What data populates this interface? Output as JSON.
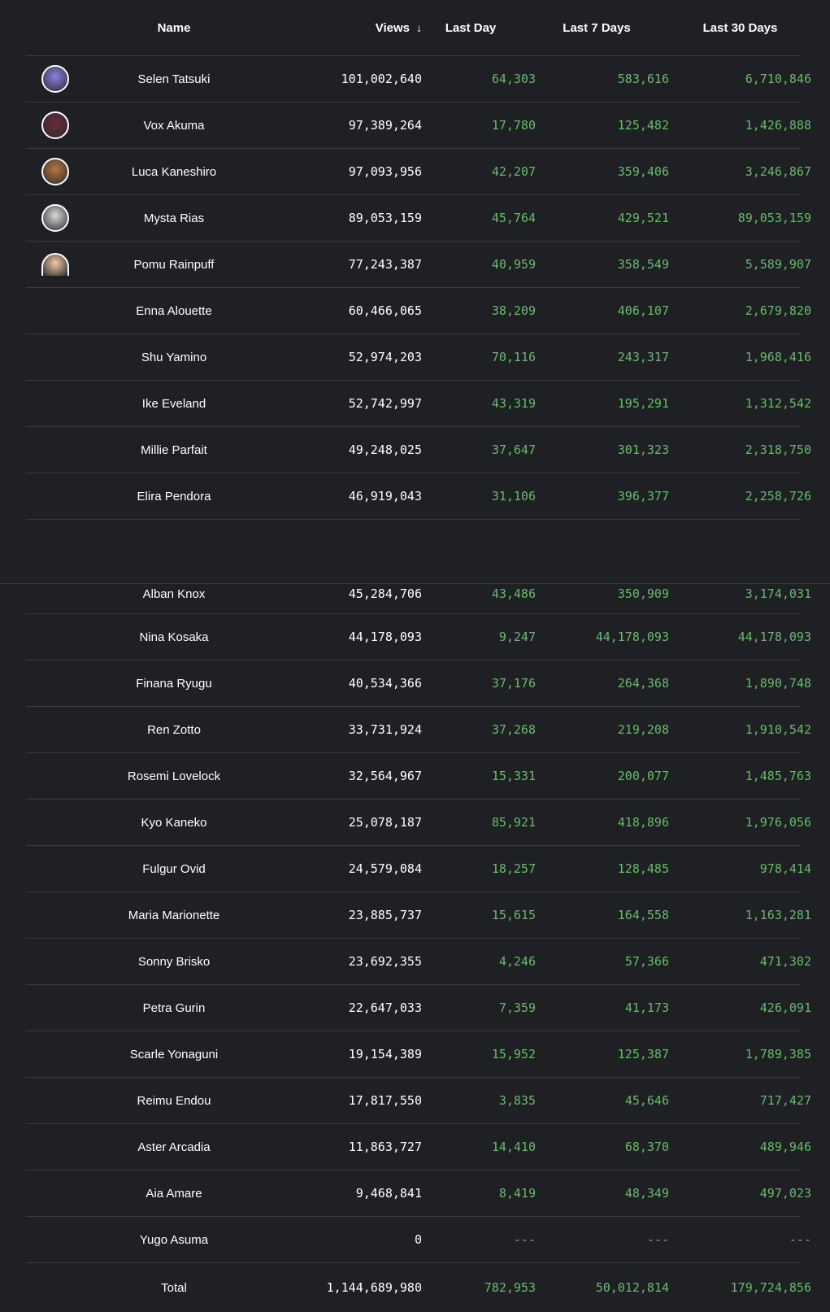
{
  "header": {
    "name": "Name",
    "views": "Views",
    "sort_icon": "arrow-down",
    "last_day": "Last Day",
    "last_7": "Last 7 Days",
    "last_30": "Last 30 Days"
  },
  "rows_top": [
    {
      "name": "Selen Tatsuki",
      "views": "101,002,640",
      "day": "64,303",
      "week": "583,616",
      "month": "6,710,846",
      "avatar": "#8a7fe0"
    },
    {
      "name": "Vox Akuma",
      "views": "97,389,264",
      "day": "17,780",
      "week": "125,482",
      "month": "1,426,888",
      "avatar": "#6b2a3a"
    },
    {
      "name": "Luca Kaneshiro",
      "views": "97,093,956",
      "day": "42,207",
      "week": "359,406",
      "month": "3,246,867",
      "avatar": "#b9763e"
    },
    {
      "name": "Mysta Rias",
      "views": "89,053,159",
      "day": "45,764",
      "week": "429,521",
      "month": "89,053,159",
      "avatar": "#d8d8d8"
    },
    {
      "name": "Pomu Rainpuff",
      "views": "77,243,387",
      "day": "40,959",
      "week": "358,549",
      "month": "5,589,907",
      "avatar": "#f3c9a2"
    },
    {
      "name": "Enna Alouette",
      "views": "60,466,065",
      "day": "38,209",
      "week": "406,107",
      "month": "2,679,820"
    },
    {
      "name": "Shu Yamino",
      "views": "52,974,203",
      "day": "70,116",
      "week": "243,317",
      "month": "1,968,416"
    },
    {
      "name": "Ike Eveland",
      "views": "52,742,997",
      "day": "43,319",
      "week": "195,291",
      "month": "1,312,542"
    },
    {
      "name": "Millie Parfait",
      "views": "49,248,025",
      "day": "37,647",
      "week": "301,323",
      "month": "2,318,750"
    },
    {
      "name": "Elira Pendora",
      "views": "46,919,043",
      "day": "31,106",
      "week": "396,377",
      "month": "2,258,726"
    }
  ],
  "rows_bottom": [
    {
      "name": "Alban Knox",
      "views": "45,284,706",
      "day": "43,486",
      "week": "350,909",
      "month": "3,174,031"
    },
    {
      "name": "Nina Kosaka",
      "views": "44,178,093",
      "day": "9,247",
      "week": "44,178,093",
      "month": "44,178,093"
    },
    {
      "name": "Finana Ryugu",
      "views": "40,534,366",
      "day": "37,176",
      "week": "264,368",
      "month": "1,890,748"
    },
    {
      "name": "Ren Zotto",
      "views": "33,731,924",
      "day": "37,268",
      "week": "219,208",
      "month": "1,910,542"
    },
    {
      "name": "Rosemi Lovelock",
      "views": "32,564,967",
      "day": "15,331",
      "week": "200,077",
      "month": "1,485,763"
    },
    {
      "name": "Kyo Kaneko",
      "views": "25,078,187",
      "day": "85,921",
      "week": "418,896",
      "month": "1,976,056"
    },
    {
      "name": "Fulgur Ovid",
      "views": "24,579,084",
      "day": "18,257",
      "week": "128,485",
      "month": "978,414"
    },
    {
      "name": "Maria Marionette",
      "views": "23,885,737",
      "day": "15,615",
      "week": "164,558",
      "month": "1,163,281"
    },
    {
      "name": "Sonny Brisko",
      "views": "23,692,355",
      "day": "4,246",
      "week": "57,366",
      "month": "471,302"
    },
    {
      "name": "Petra Gurin",
      "views": "22,647,033",
      "day": "7,359",
      "week": "41,173",
      "month": "426,091"
    },
    {
      "name": "Scarle Yonaguni",
      "views": "19,154,389",
      "day": "15,952",
      "week": "125,387",
      "month": "1,789,385"
    },
    {
      "name": "Reimu Endou",
      "views": "17,817,550",
      "day": "3,835",
      "week": "45,646",
      "month": "717,427"
    },
    {
      "name": "Aster Arcadia",
      "views": "11,863,727",
      "day": "14,410",
      "week": "68,370",
      "month": "489,946"
    },
    {
      "name": "Aia Amare",
      "views": "9,468,841",
      "day": "8,419",
      "week": "48,349",
      "month": "497,023"
    },
    {
      "name": "Yugo Asuma",
      "views": "0",
      "day": "---",
      "week": "---",
      "month": "---"
    }
  ],
  "total": {
    "name": "Total",
    "views": "1,144,689,980",
    "day": "782,953",
    "week": "50,012,814",
    "month": "179,724,856"
  }
}
